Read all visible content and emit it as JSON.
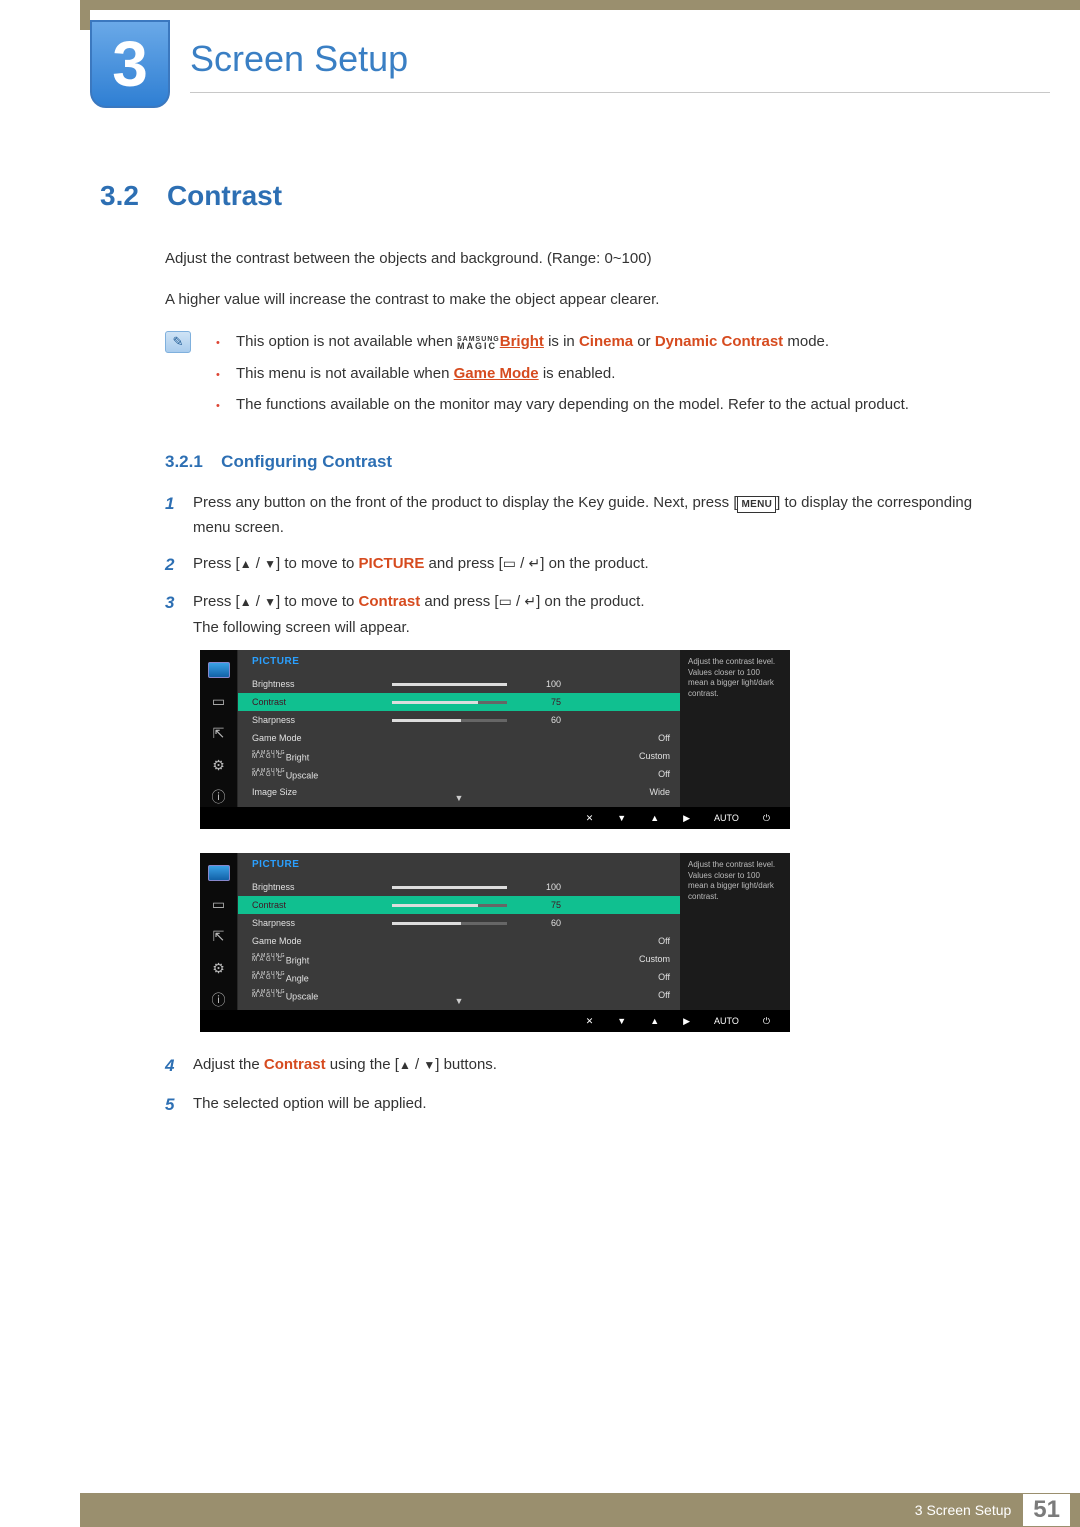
{
  "chapter": {
    "num": "3",
    "title": "Screen Setup"
  },
  "section": {
    "num": "3.2",
    "title": "Contrast"
  },
  "intro1": "Adjust the contrast between the objects and background. (Range: 0~100)",
  "intro2": "A higher value will increase the contrast to make the object appear clearer.",
  "notes": {
    "n1a": "This option is not available when ",
    "n1b": " is in ",
    "n1c": " or ",
    "n1d": " mode.",
    "cinema": "Cinema",
    "dyncon": "Dynamic Contrast",
    "bright_link": "Bright",
    "magic_top": "SAMSUNG",
    "magic_bot": "MAGIC",
    "n2a": "This menu is not available when ",
    "n2b": " is enabled.",
    "gamemode_link": "Game Mode",
    "n3": "The functions available on the monitor may vary depending on the model. Refer to the actual product."
  },
  "subsection": {
    "num": "3.2.1",
    "title": "Configuring Contrast"
  },
  "steps": {
    "s1a": "Press any button on the front of the product to display the Key guide. Next, press [",
    "s1b": "] to display the corresponding menu screen.",
    "menu_btn": "MENU",
    "s2a": "Press [",
    "s2b": "] to move to ",
    "s2c": " and press [",
    "s2d": "] on the product.",
    "picture_b": "PICTURE",
    "s3a": "Press [",
    "s3b": "] to move to ",
    "s3c": " and press [",
    "s3d": "] on the product.",
    "contrast_b": "Contrast",
    "s3e": "The following screen will appear.",
    "s4a": "Adjust the ",
    "s4b": " using the [",
    "s4c": "] buttons.",
    "s5": "The selected option will be applied."
  },
  "osd": {
    "title": "PICTURE",
    "tip": "Adjust the contrast level. Values closer to 100 mean a bigger light/dark contrast.",
    "auto": "AUTO",
    "screen1": {
      "rows": [
        {
          "label": "Brightness",
          "type": "slider",
          "fill": 100,
          "val": "100"
        },
        {
          "label": "Contrast",
          "type": "slider",
          "fill": 75,
          "val": "75",
          "sel": true
        },
        {
          "label": "Sharpness",
          "type": "slider",
          "fill": 60,
          "val": "60"
        },
        {
          "label": "Game Mode",
          "type": "text",
          "val": "Off"
        },
        {
          "label_magic": "Bright",
          "type": "text",
          "val": "Custom"
        },
        {
          "label_magic": "Upscale",
          "type": "text",
          "val": "Off"
        },
        {
          "label": "Image Size",
          "type": "text",
          "val": "Wide"
        }
      ]
    },
    "screen2": {
      "rows": [
        {
          "label": "Brightness",
          "type": "slider",
          "fill": 100,
          "val": "100"
        },
        {
          "label": "Contrast",
          "type": "slider",
          "fill": 75,
          "val": "75",
          "sel": true
        },
        {
          "label": "Sharpness",
          "type": "slider",
          "fill": 60,
          "val": "60"
        },
        {
          "label": "Game Mode",
          "type": "text",
          "val": "Off"
        },
        {
          "label_magic": "Bright",
          "type": "text",
          "val": "Custom"
        },
        {
          "label_magic": "Angle",
          "type": "text",
          "val": "Off"
        },
        {
          "label_magic": "Upscale",
          "type": "text",
          "val": "Off"
        }
      ]
    }
  },
  "footer": {
    "text": "3 Screen Setup",
    "page": "51"
  }
}
